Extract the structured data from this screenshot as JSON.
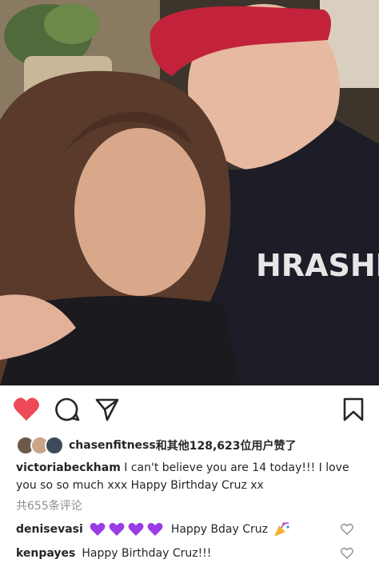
{
  "post": {
    "likes": {
      "username": "chasenfitness",
      "text": "和其他128,623位用户赞了"
    },
    "caption": {
      "username": "victoriabeckham",
      "text": " I can't believe you are 14 today!!! I love you so so much xxx Happy Birthday Cruz xx"
    },
    "comments_count": "共655条评论",
    "comments": [
      {
        "username": "denisevasi",
        "text": "Happy Bday Cruz",
        "hearts": 4,
        "emoji": "party-popper"
      },
      {
        "username": "kenpayes",
        "text": "Happy Birthday Cruz!!!"
      }
    ],
    "photo_text": "HRASHE"
  },
  "icons": {
    "like": "heart-filled-icon",
    "comment": "comment-bubble-icon",
    "share": "paper-plane-icon",
    "save": "bookmark-icon",
    "comment_like": "heart-outline-icon"
  },
  "colors": {
    "like": "#ed4956",
    "emoji_heart": "#9b3de6",
    "secondary_text": "#8e8e8e"
  }
}
